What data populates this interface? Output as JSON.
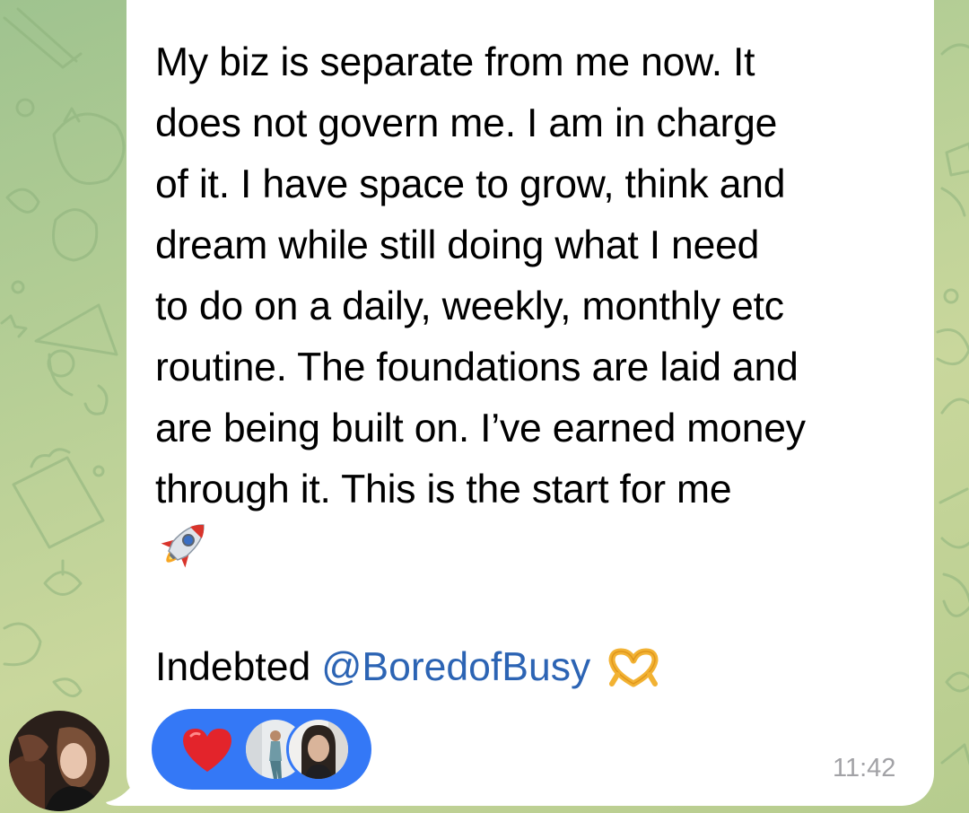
{
  "chat": {
    "message": {
      "text": "My biz is separate from me now. It\ndoes not govern me. I am in charge\nof it. I have space to grow, think and\ndream while still doing what I need\nto do on a daily, weekly, monthly etc\nroutine. The foundations are laid and\nare being built on. I’ve earned money\nthrough it. This is the start for me",
      "emoji_after_text": "rocket",
      "signoff_text": "Indebted",
      "mention": "@BoredofBusy",
      "signoff_emoji": "heart-hands",
      "time": "11:42"
    },
    "reaction": {
      "emoji": "red-heart",
      "reactor_count": 2
    }
  },
  "colors": {
    "bubble": "#ffffff",
    "mention": "#2c64b4",
    "reaction_pill": "#3478f6",
    "timestamp": "#a2a2a6",
    "wallpaper": "#b4cd92"
  }
}
